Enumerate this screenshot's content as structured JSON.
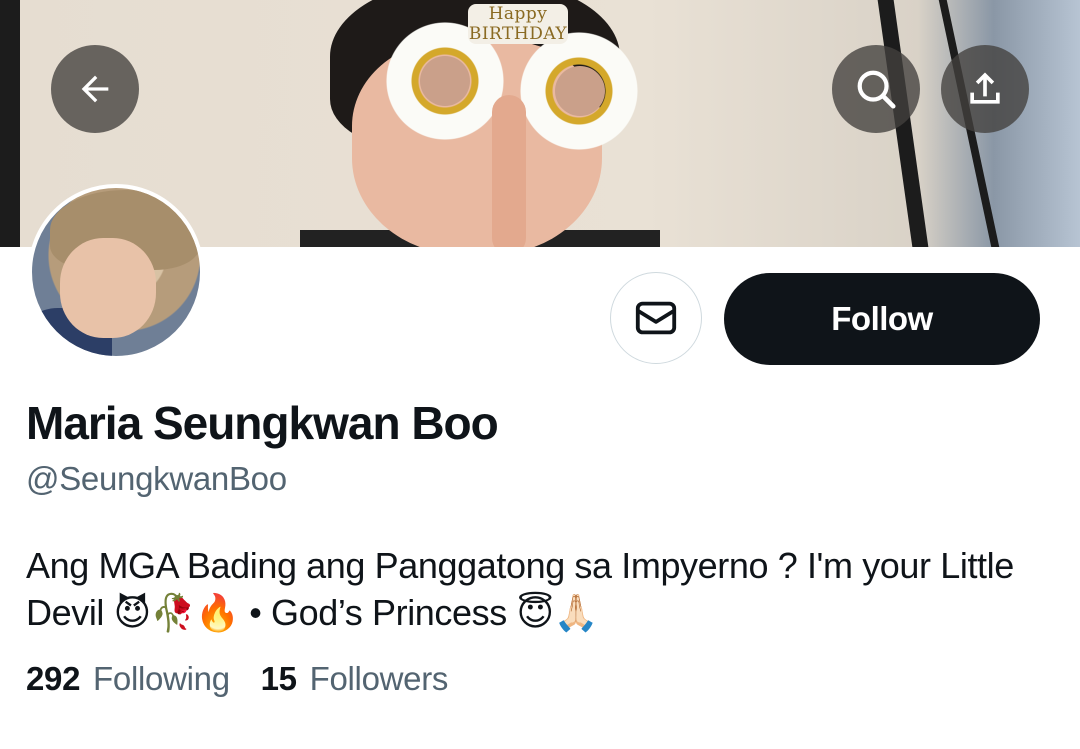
{
  "banner": {
    "overlay_text": "Happy BIRTHDAY"
  },
  "header_buttons": {
    "back_icon": "arrow-left-icon",
    "search_icon": "search-icon",
    "share_icon": "share-icon"
  },
  "actions": {
    "message_icon": "envelope-icon",
    "follow_label": "Follow"
  },
  "profile": {
    "display_name": "Maria Seungkwan Boo",
    "handle": "@SeungkwanBoo",
    "bio": "Ang MGA Bading ang Panggatong sa Impyerno ? I'm your Little Devil 😈🥀🔥 • God’s Princess 😇🙏🏻"
  },
  "stats": {
    "following_count": "292",
    "following_label": "Following",
    "followers_count": "15",
    "followers_label": "Followers"
  },
  "colors": {
    "text_primary": "#0f1419",
    "text_secondary": "#536471",
    "button_dark": "#0f1419",
    "border": "#cfd9de"
  }
}
